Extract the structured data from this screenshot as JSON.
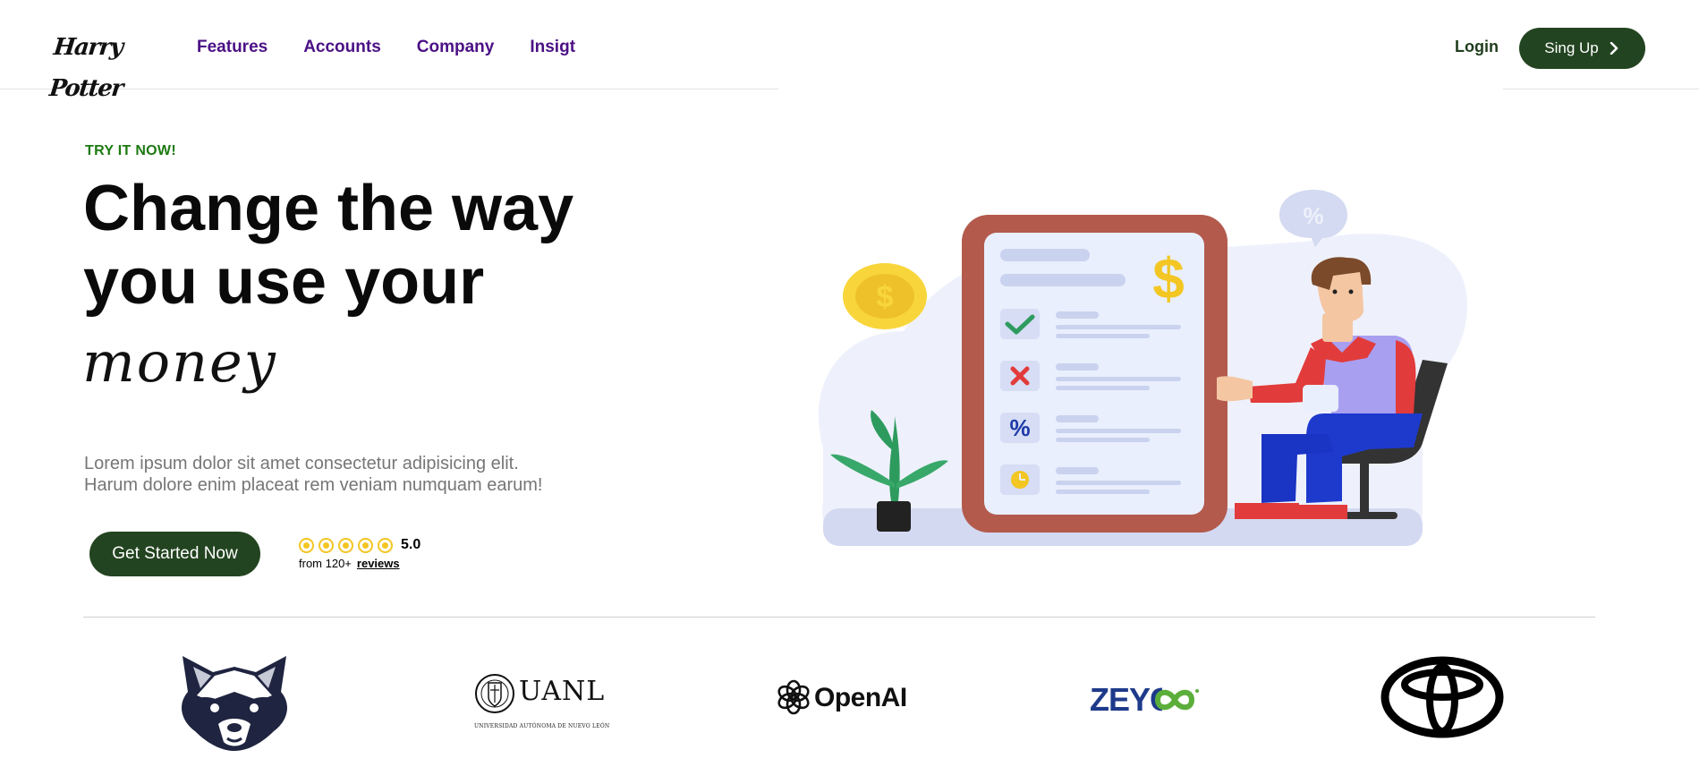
{
  "header": {
    "logo_text": "Harry Potter",
    "nav": [
      "Features",
      "Accounts",
      "Company",
      "Insigt"
    ],
    "login_label": "Login",
    "signup_label": "Sing Up"
  },
  "hero": {
    "eyebrow": "TRY IT NOW!",
    "headline_line1": "Change the way",
    "headline_line2": "you use your",
    "script_word": "money",
    "description_line1": "Lorem ipsum dolor sit amet consectetur adipisicing elit.",
    "description_line2": "Harum dolore enim placeat rem veniam numquam earum!",
    "cta_label": "Get Started Now",
    "rating": {
      "stars": 5,
      "score": "5.0",
      "from_text": "from 120+",
      "reviews_link": "reviews"
    }
  },
  "logos": {
    "uanl_name": "UANL",
    "uanl_subtitle": "UNIVERSIDAD AUTÓNOMA DE NUEVO LEÓN",
    "openai_name": "OpenAI",
    "zeyco_name": "ZEYCO"
  },
  "colors": {
    "nav_purple": "#4b1185",
    "brand_green": "#234420",
    "accent_green": "#1d7a12",
    "star_yellow": "#f3c623",
    "frame_red": "#b35a4d"
  }
}
